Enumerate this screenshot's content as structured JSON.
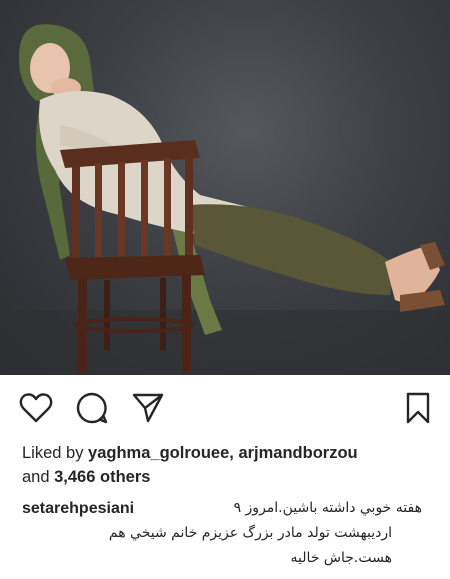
{
  "post": {
    "image_alt": "photo-of-woman-on-chair"
  },
  "actions": {
    "like_icon": "heart-outline-icon",
    "comment_icon": "comment-bubble-icon",
    "share_icon": "paper-plane-icon",
    "save_icon": "bookmark-outline-icon"
  },
  "likes": {
    "prefix": "Liked by ",
    "user1": "yaghma_golrouee",
    "separator": ", ",
    "user2": "arjmandborzou",
    "and": "and ",
    "count": "3,466 others"
  },
  "caption": {
    "username": "setarehpesiani",
    "line1": "هفته خوبي داشته باشين.امروز ٩",
    "line2": "ارديبهشت تولد مادر بزرگ عزيزم خانم شيخي هم",
    "line3": "هست.جاش خاليه"
  },
  "colors": {
    "text": "#262626",
    "background": "#ffffff"
  }
}
